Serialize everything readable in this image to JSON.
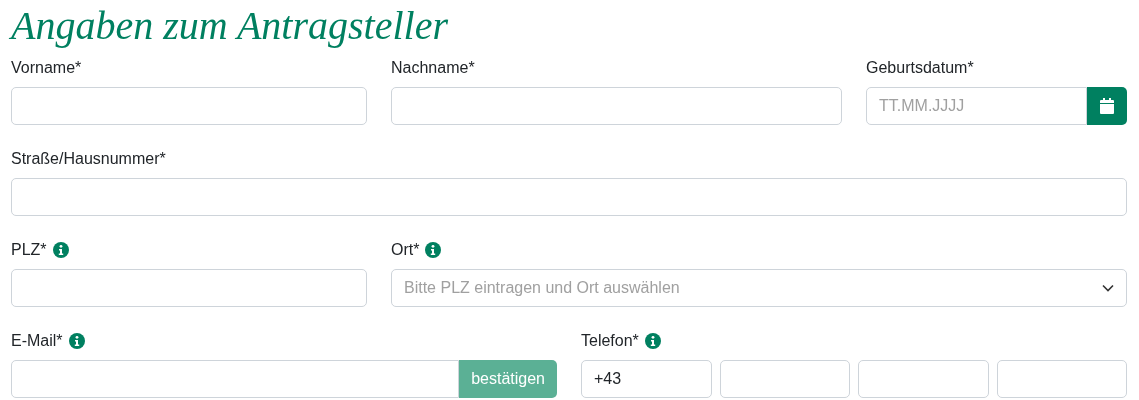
{
  "title": "Angaben zum Antragsteller",
  "rows": [
    [
      {
        "kind": "text",
        "label": "Vorname*",
        "info": false
      },
      {
        "kind": "text",
        "label": "Nachname*",
        "info": false
      },
      {
        "kind": "date",
        "label": "Geburtsdatum*",
        "info": false,
        "placeholder": "TT.MM.JJJJ"
      }
    ],
    [
      {
        "kind": "text",
        "label": "Straße/Hausnummer*",
        "info": false
      }
    ],
    [
      {
        "kind": "text",
        "label": "PLZ*",
        "info": true
      },
      {
        "kind": "select",
        "label": "Ort*",
        "info": true,
        "placeholder": "Bitte PLZ eintragen und Ort auswählen"
      }
    ],
    [
      {
        "kind": "email",
        "label": "E-Mail*",
        "info": true,
        "button": {
          "label": "bestätigen",
          "disabled": true
        }
      },
      {
        "kind": "phone",
        "label": "Telefon*",
        "info": true,
        "parts": [
          {
            "kind": "prefix",
            "value": "+43"
          },
          {
            "kind": "blank"
          },
          {
            "kind": "blank"
          },
          {
            "kind": "blank"
          }
        ]
      }
    ]
  ]
}
